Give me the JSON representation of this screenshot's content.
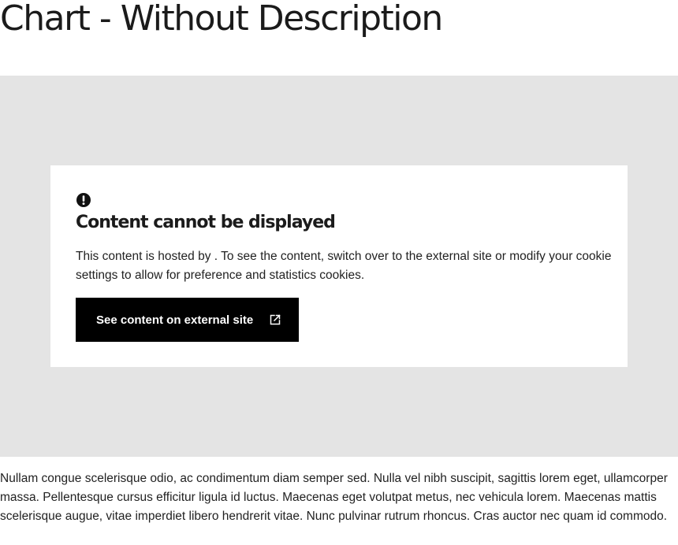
{
  "page": {
    "title": "Chart - Without Description"
  },
  "embed": {
    "background_color": "#e4e4e4",
    "notice": {
      "icon": "exclamation-circle-icon",
      "heading": "Content cannot be displayed",
      "message": "This content is hosted by . To see the content, switch over to the external site or modify your cookie settings to allow for preference and statistics cookies.",
      "button": {
        "label": "See content on external site",
        "icon": "external-link-icon",
        "background_color": "#000000",
        "text_color": "#ffffff"
      }
    }
  },
  "body": {
    "paragraph": "Nullam congue scelerisque odio, ac condimentum diam semper sed. Nulla vel nibh suscipit, sagittis lorem eget, ullamcorper massa. Pellentesque cursus efficitur ligula id luctus. Maecenas eget volutpat metus, nec vehicula lorem. Maecenas mattis scelerisque augue, vitae imperdiet libero hendrerit vitae. Nunc pulvinar rutrum rhoncus. Cras auctor nec quam id commodo."
  }
}
